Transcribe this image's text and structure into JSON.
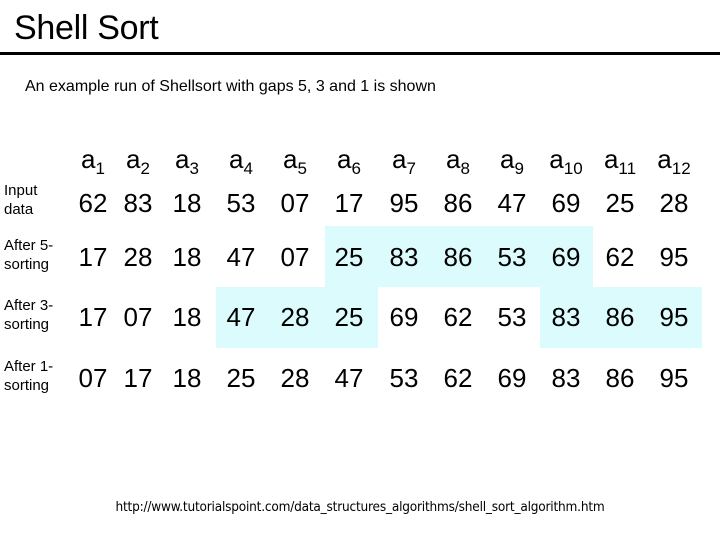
{
  "title": "Shell Sort",
  "subtitle": "An example run of Shellsort with gaps 5, 3 and 1 is shown",
  "header": {
    "symbol": "a",
    "indices": [
      "1",
      "2",
      "3",
      "4",
      "5",
      "6",
      "7",
      "8",
      "9",
      "10",
      "11",
      "12"
    ]
  },
  "rows": [
    {
      "label_line1": "Input",
      "label_line2": "data",
      "values": [
        "62",
        "83",
        "18",
        "53",
        "07",
        "17",
        "95",
        "86",
        "47",
        "69",
        "25",
        "28"
      ],
      "highlighted_indices": []
    },
    {
      "label_line1": "After 5-",
      "label_line2": "sorting",
      "values": [
        "17",
        "28",
        "18",
        "47",
        "07",
        "25",
        "83",
        "86",
        "53",
        "69",
        "62",
        "95"
      ],
      "highlighted_indices": [
        6,
        7,
        8,
        9,
        10
      ]
    },
    {
      "label_line1": "After 3-",
      "label_line2": "sorting",
      "values": [
        "17",
        "07",
        "18",
        "47",
        "28",
        "25",
        "69",
        "62",
        "53",
        "83",
        "86",
        "95"
      ],
      "highlighted_indices": [
        4,
        5,
        6,
        10,
        11,
        12
      ]
    },
    {
      "label_line1": "After 1-",
      "label_line2": "sorting",
      "values": [
        "07",
        "17",
        "18",
        "25",
        "28",
        "47",
        "53",
        "62",
        "69",
        "83",
        "86",
        "95"
      ],
      "highlighted_indices": []
    }
  ],
  "colors": {
    "highlight": "#dcfbfd",
    "text": "#000000"
  },
  "source_url": "http://www.tutorialspoint.com/data_structures_algorithms/shell_sort_algorithm.htm"
}
